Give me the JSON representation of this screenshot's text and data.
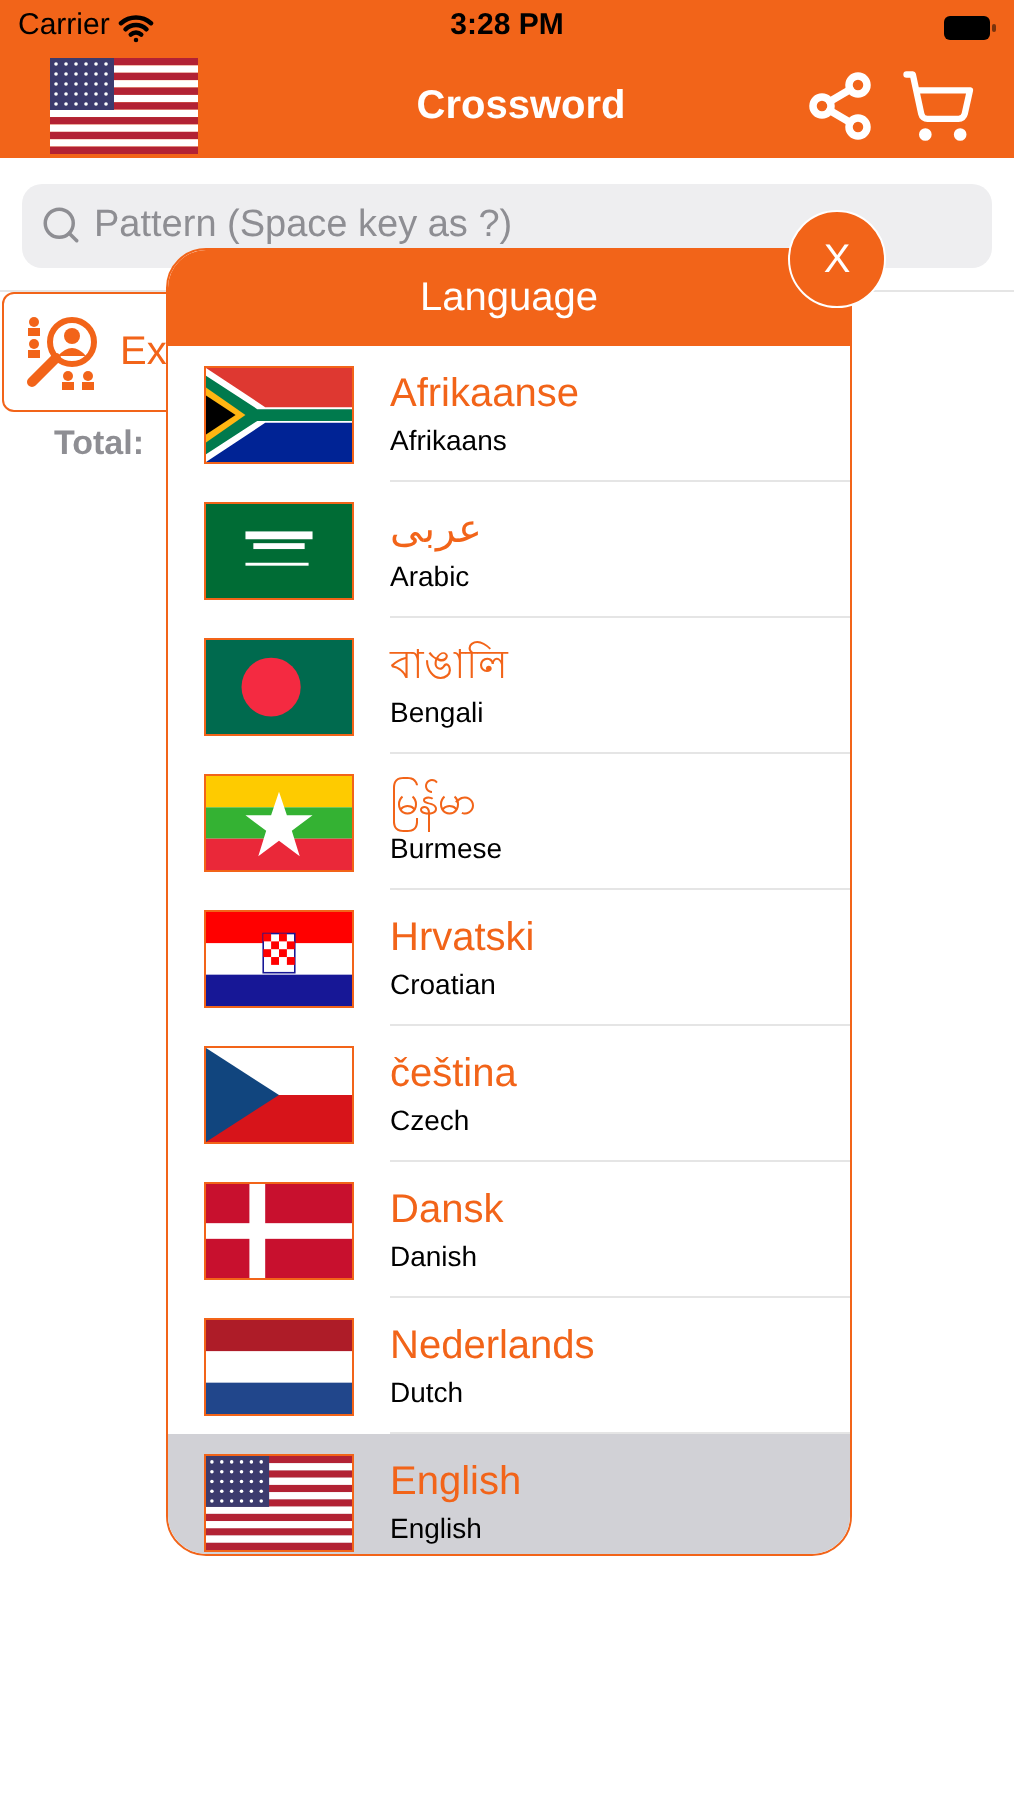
{
  "status_bar": {
    "carrier": "Carrier",
    "time": "3:28 PM"
  },
  "header": {
    "title": "Crossword"
  },
  "search": {
    "placeholder": "Pattern (Space key as ?)"
  },
  "background": {
    "card_label": "Ex",
    "total_label": "Total:"
  },
  "dialog": {
    "title": "Language",
    "close": "X",
    "languages": [
      {
        "name": "Afrikaanse",
        "english": "Afrikaans",
        "selected": false
      },
      {
        "name": "عربى",
        "english": "Arabic",
        "selected": false
      },
      {
        "name": "বাঙালি",
        "english": "Bengali",
        "selected": false
      },
      {
        "name": "မြန်မာ",
        "english": "Burmese",
        "selected": false
      },
      {
        "name": "Hrvatski",
        "english": "Croatian",
        "selected": false
      },
      {
        "name": "čeština",
        "english": "Czech",
        "selected": false
      },
      {
        "name": "Dansk",
        "english": "Danish",
        "selected": false
      },
      {
        "name": "Nederlands",
        "english": "Dutch",
        "selected": false
      },
      {
        "name": "English",
        "english": "English",
        "selected": true
      }
    ]
  }
}
